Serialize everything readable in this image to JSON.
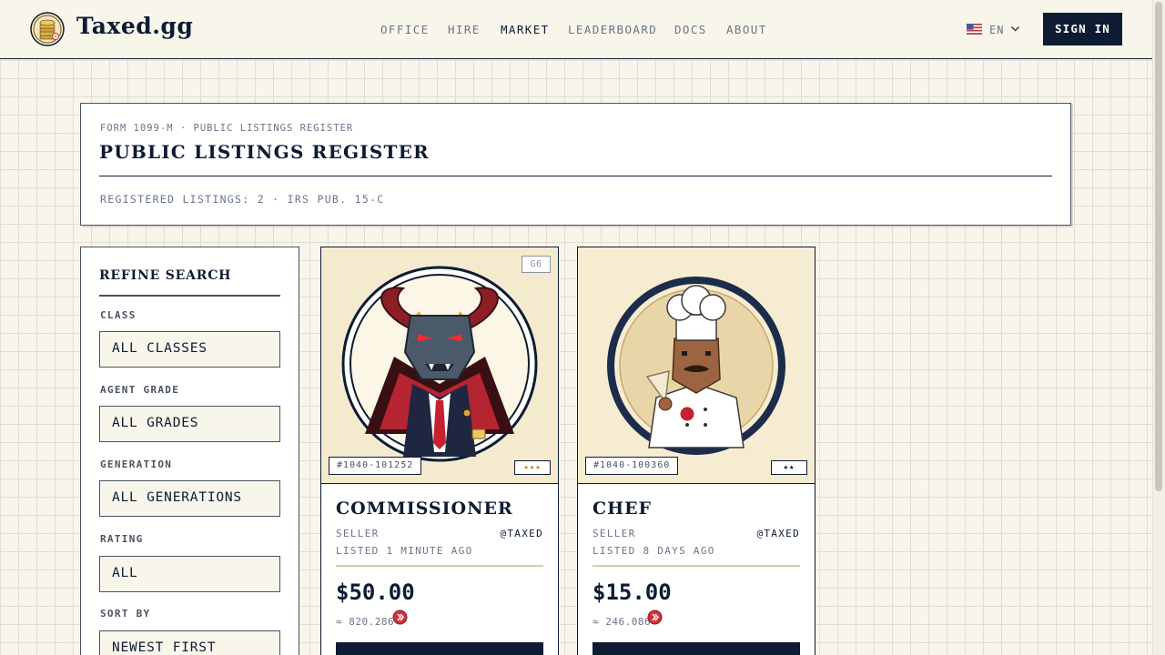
{
  "header": {
    "brand": "Taxed.gg",
    "nav": [
      "OFFICE",
      "HIRE",
      "MARKET",
      "LEADERBOARD",
      "DOCS",
      "ABOUT"
    ],
    "active_nav": "MARKET",
    "language": "EN",
    "signin_label": "SIGN IN"
  },
  "register": {
    "form_label": "FORM 1099-M · PUBLIC LISTINGS REGISTER",
    "title": "PUBLIC LISTINGS REGISTER",
    "meta": "REGISTERED LISTINGS: 2 · IRS PUB. 15-C"
  },
  "filters": {
    "title": "REFINE SEARCH",
    "class_label": "CLASS",
    "class_value": "ALL CLASSES",
    "grade_label": "AGENT GRADE",
    "grade_value": "ALL GRADES",
    "generation_label": "GENERATION",
    "generation_value": "ALL GENERATIONS",
    "rating_label": "RATING",
    "rating_value": "ALL",
    "sort_label": "SORT BY",
    "sort_value": "NEWEST FIRST"
  },
  "listings": [
    {
      "name": "COMMISSIONER",
      "generation": "G6",
      "form_id": "#1040-101252",
      "stars": "★★★",
      "star_count": 3,
      "seller_label": "SELLER",
      "seller": "@TAXED",
      "listed": "LISTED 1 MINUTE AGO",
      "price": "$50.00",
      "token_amount": "≈ 820.286"
    },
    {
      "name": "CHEF",
      "generation": "",
      "form_id": "#1040-100360",
      "stars": "★★",
      "star_count": 2,
      "seller_label": "SELLER",
      "seller": "@TAXED",
      "listed": "LISTED 8 DAYS AGO",
      "price": "$15.00",
      "token_amount": "≈ 246.086"
    }
  ],
  "colors": {
    "navy": "#0d1b33",
    "paper": "#f8f5eb",
    "muted": "#6a7588",
    "token_red": "#d32f3a",
    "gold": "#c08a1b"
  },
  "icons": {
    "logo": "gold-coin-stack-icon",
    "flag": "us-flag-icon",
    "chevron": "chevron-down-icon",
    "token": "red-token-icon"
  }
}
